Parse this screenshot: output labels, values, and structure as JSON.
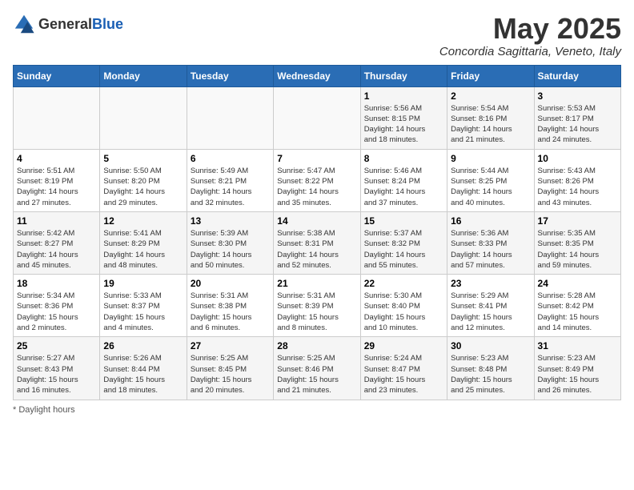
{
  "logo": {
    "general": "General",
    "blue": "Blue"
  },
  "title": "May 2025",
  "subtitle": "Concordia Sagittaria, Veneto, Italy",
  "days_of_week": [
    "Sunday",
    "Monday",
    "Tuesday",
    "Wednesday",
    "Thursday",
    "Friday",
    "Saturday"
  ],
  "footer": {
    "daylight_label": "Daylight hours"
  },
  "weeks": [
    {
      "days": [
        {
          "num": "",
          "info": ""
        },
        {
          "num": "",
          "info": ""
        },
        {
          "num": "",
          "info": ""
        },
        {
          "num": "",
          "info": ""
        },
        {
          "num": "1",
          "info": "Sunrise: 5:56 AM\nSunset: 8:15 PM\nDaylight: 14 hours\nand 18 minutes."
        },
        {
          "num": "2",
          "info": "Sunrise: 5:54 AM\nSunset: 8:16 PM\nDaylight: 14 hours\nand 21 minutes."
        },
        {
          "num": "3",
          "info": "Sunrise: 5:53 AM\nSunset: 8:17 PM\nDaylight: 14 hours\nand 24 minutes."
        }
      ]
    },
    {
      "days": [
        {
          "num": "4",
          "info": "Sunrise: 5:51 AM\nSunset: 8:19 PM\nDaylight: 14 hours\nand 27 minutes."
        },
        {
          "num": "5",
          "info": "Sunrise: 5:50 AM\nSunset: 8:20 PM\nDaylight: 14 hours\nand 29 minutes."
        },
        {
          "num": "6",
          "info": "Sunrise: 5:49 AM\nSunset: 8:21 PM\nDaylight: 14 hours\nand 32 minutes."
        },
        {
          "num": "7",
          "info": "Sunrise: 5:47 AM\nSunset: 8:22 PM\nDaylight: 14 hours\nand 35 minutes."
        },
        {
          "num": "8",
          "info": "Sunrise: 5:46 AM\nSunset: 8:24 PM\nDaylight: 14 hours\nand 37 minutes."
        },
        {
          "num": "9",
          "info": "Sunrise: 5:44 AM\nSunset: 8:25 PM\nDaylight: 14 hours\nand 40 minutes."
        },
        {
          "num": "10",
          "info": "Sunrise: 5:43 AM\nSunset: 8:26 PM\nDaylight: 14 hours\nand 43 minutes."
        }
      ]
    },
    {
      "days": [
        {
          "num": "11",
          "info": "Sunrise: 5:42 AM\nSunset: 8:27 PM\nDaylight: 14 hours\nand 45 minutes."
        },
        {
          "num": "12",
          "info": "Sunrise: 5:41 AM\nSunset: 8:29 PM\nDaylight: 14 hours\nand 48 minutes."
        },
        {
          "num": "13",
          "info": "Sunrise: 5:39 AM\nSunset: 8:30 PM\nDaylight: 14 hours\nand 50 minutes."
        },
        {
          "num": "14",
          "info": "Sunrise: 5:38 AM\nSunset: 8:31 PM\nDaylight: 14 hours\nand 52 minutes."
        },
        {
          "num": "15",
          "info": "Sunrise: 5:37 AM\nSunset: 8:32 PM\nDaylight: 14 hours\nand 55 minutes."
        },
        {
          "num": "16",
          "info": "Sunrise: 5:36 AM\nSunset: 8:33 PM\nDaylight: 14 hours\nand 57 minutes."
        },
        {
          "num": "17",
          "info": "Sunrise: 5:35 AM\nSunset: 8:35 PM\nDaylight: 14 hours\nand 59 minutes."
        }
      ]
    },
    {
      "days": [
        {
          "num": "18",
          "info": "Sunrise: 5:34 AM\nSunset: 8:36 PM\nDaylight: 15 hours\nand 2 minutes."
        },
        {
          "num": "19",
          "info": "Sunrise: 5:33 AM\nSunset: 8:37 PM\nDaylight: 15 hours\nand 4 minutes."
        },
        {
          "num": "20",
          "info": "Sunrise: 5:31 AM\nSunset: 8:38 PM\nDaylight: 15 hours\nand 6 minutes."
        },
        {
          "num": "21",
          "info": "Sunrise: 5:31 AM\nSunset: 8:39 PM\nDaylight: 15 hours\nand 8 minutes."
        },
        {
          "num": "22",
          "info": "Sunrise: 5:30 AM\nSunset: 8:40 PM\nDaylight: 15 hours\nand 10 minutes."
        },
        {
          "num": "23",
          "info": "Sunrise: 5:29 AM\nSunset: 8:41 PM\nDaylight: 15 hours\nand 12 minutes."
        },
        {
          "num": "24",
          "info": "Sunrise: 5:28 AM\nSunset: 8:42 PM\nDaylight: 15 hours\nand 14 minutes."
        }
      ]
    },
    {
      "days": [
        {
          "num": "25",
          "info": "Sunrise: 5:27 AM\nSunset: 8:43 PM\nDaylight: 15 hours\nand 16 minutes."
        },
        {
          "num": "26",
          "info": "Sunrise: 5:26 AM\nSunset: 8:44 PM\nDaylight: 15 hours\nand 18 minutes."
        },
        {
          "num": "27",
          "info": "Sunrise: 5:25 AM\nSunset: 8:45 PM\nDaylight: 15 hours\nand 20 minutes."
        },
        {
          "num": "28",
          "info": "Sunrise: 5:25 AM\nSunset: 8:46 PM\nDaylight: 15 hours\nand 21 minutes."
        },
        {
          "num": "29",
          "info": "Sunrise: 5:24 AM\nSunset: 8:47 PM\nDaylight: 15 hours\nand 23 minutes."
        },
        {
          "num": "30",
          "info": "Sunrise: 5:23 AM\nSunset: 8:48 PM\nDaylight: 15 hours\nand 25 minutes."
        },
        {
          "num": "31",
          "info": "Sunrise: 5:23 AM\nSunset: 8:49 PM\nDaylight: 15 hours\nand 26 minutes."
        }
      ]
    }
  ]
}
